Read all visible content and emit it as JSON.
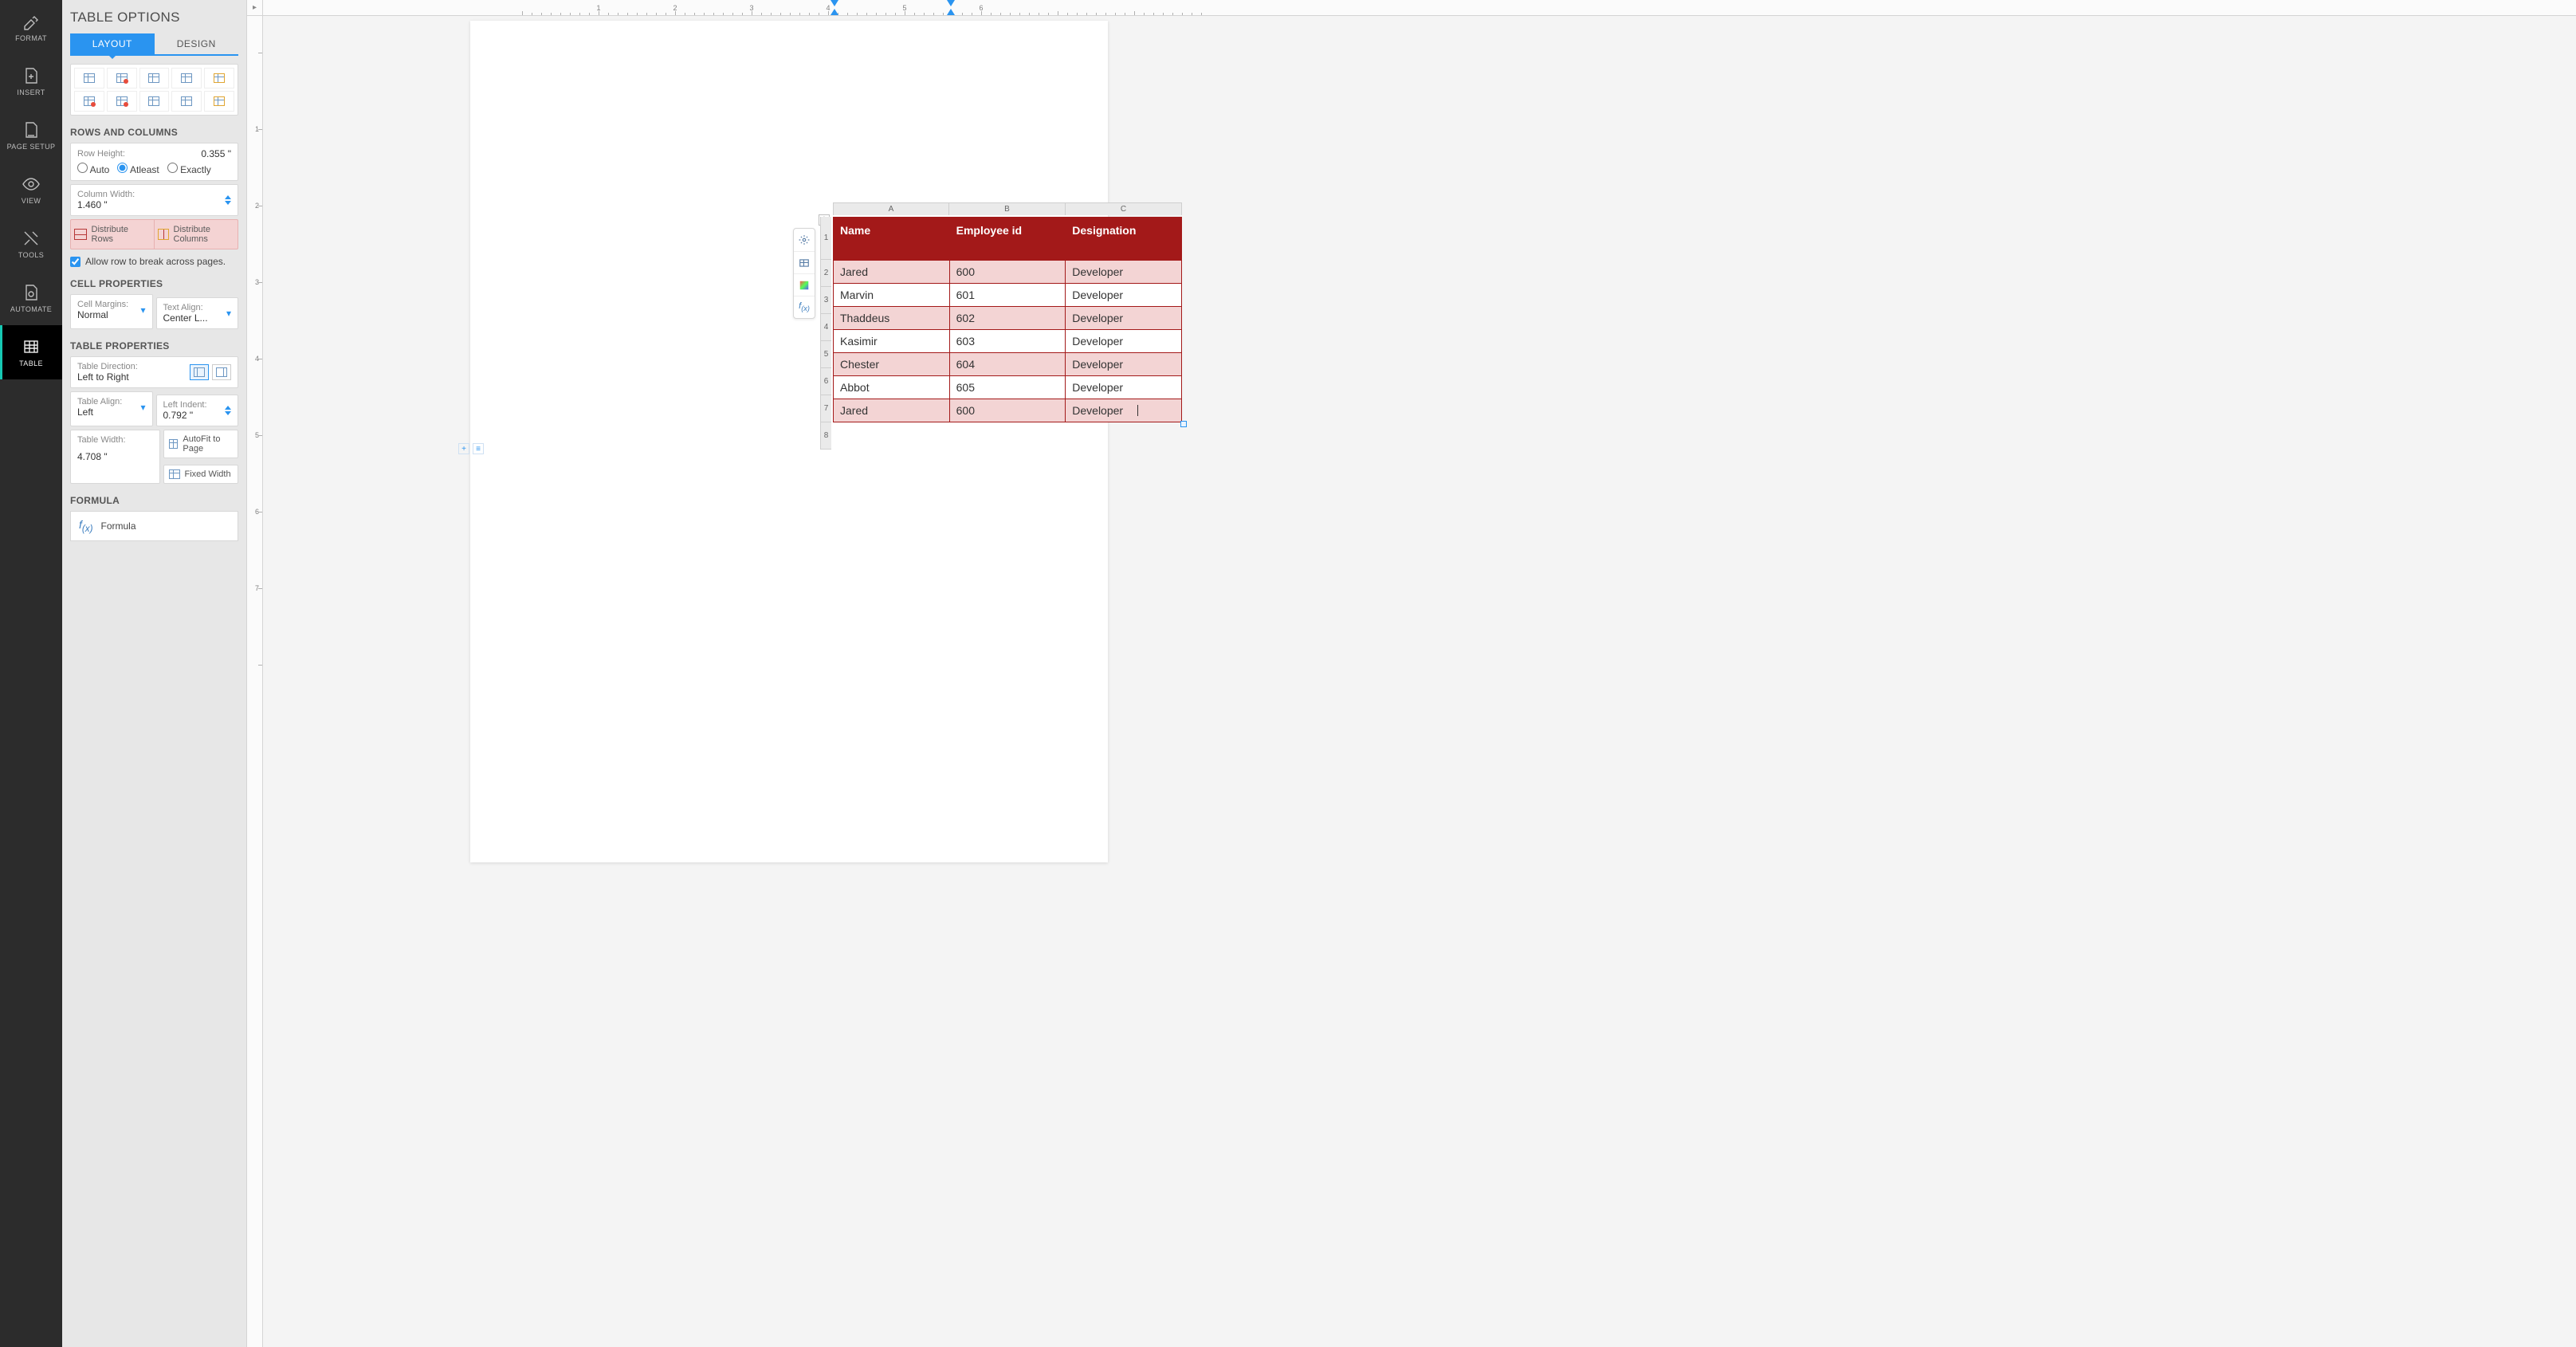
{
  "rail": {
    "format": "FORMAT",
    "insert": "INSERT",
    "page_setup": "PAGE SETUP",
    "view": "VIEW",
    "tools": "TOOLS",
    "automate": "AUTOMATE",
    "table": "TABLE"
  },
  "panel": {
    "title": "TABLE OPTIONS",
    "tab_layout": "LAYOUT",
    "tab_design": "DESIGN",
    "rows_cols_title": "ROWS AND COLUMNS",
    "row_height_label": "Row Height:",
    "row_height_value": "0.355 \"",
    "radio_auto": "Auto",
    "radio_atleast": "Atleast",
    "radio_exactly": "Exactly",
    "col_width_label": "Column Width:",
    "col_width_value": "1.460 \"",
    "dist_rows": "Distribute Rows",
    "dist_cols": "Distribute Columns",
    "allow_break": "Allow row to break across pages.",
    "cell_props_title": "CELL PROPERTIES",
    "cell_margins_label": "Cell Margins:",
    "cell_margins_value": "Normal",
    "text_align_label": "Text Align:",
    "text_align_value": "Center L...",
    "table_props_title": "TABLE PROPERTIES",
    "table_dir_label": "Table Direction:",
    "table_dir_value": "Left to Right",
    "table_align_label": "Table Align:",
    "table_align_value": "Left",
    "left_indent_label": "Left Indent:",
    "left_indent_value": "0.792 \"",
    "table_width_label": "Table Width:",
    "table_width_value": "4.708 \"",
    "autofit_page": "AutoFit to Page",
    "fixed_width": "Fixed Width",
    "formula_title": "FORMULA",
    "formula_btn": "Formula"
  },
  "ruler": {
    "nums": [
      "1",
      "2",
      "3",
      "4",
      "5",
      "6"
    ],
    "vnums": [
      "1",
      "2",
      "3",
      "4",
      "5",
      "6",
      "7"
    ]
  },
  "table": {
    "col_letters": [
      "A",
      "B",
      "C"
    ],
    "row_nums": [
      "1",
      "2",
      "3",
      "4",
      "5",
      "6",
      "7",
      "8"
    ],
    "headers": [
      "Name",
      "Employee id",
      "Designation"
    ],
    "rows": [
      [
        "Jared",
        "600",
        "Developer"
      ],
      [
        "Marvin",
        "601",
        "Developer"
      ],
      [
        "Thaddeus",
        "602",
        "Developer"
      ],
      [
        "Kasimir",
        "603",
        "Developer"
      ],
      [
        "Chester",
        "604",
        "Developer"
      ],
      [
        "Abbot",
        "605",
        "Developer"
      ],
      [
        "Jared",
        "600",
        "Developer"
      ]
    ]
  }
}
